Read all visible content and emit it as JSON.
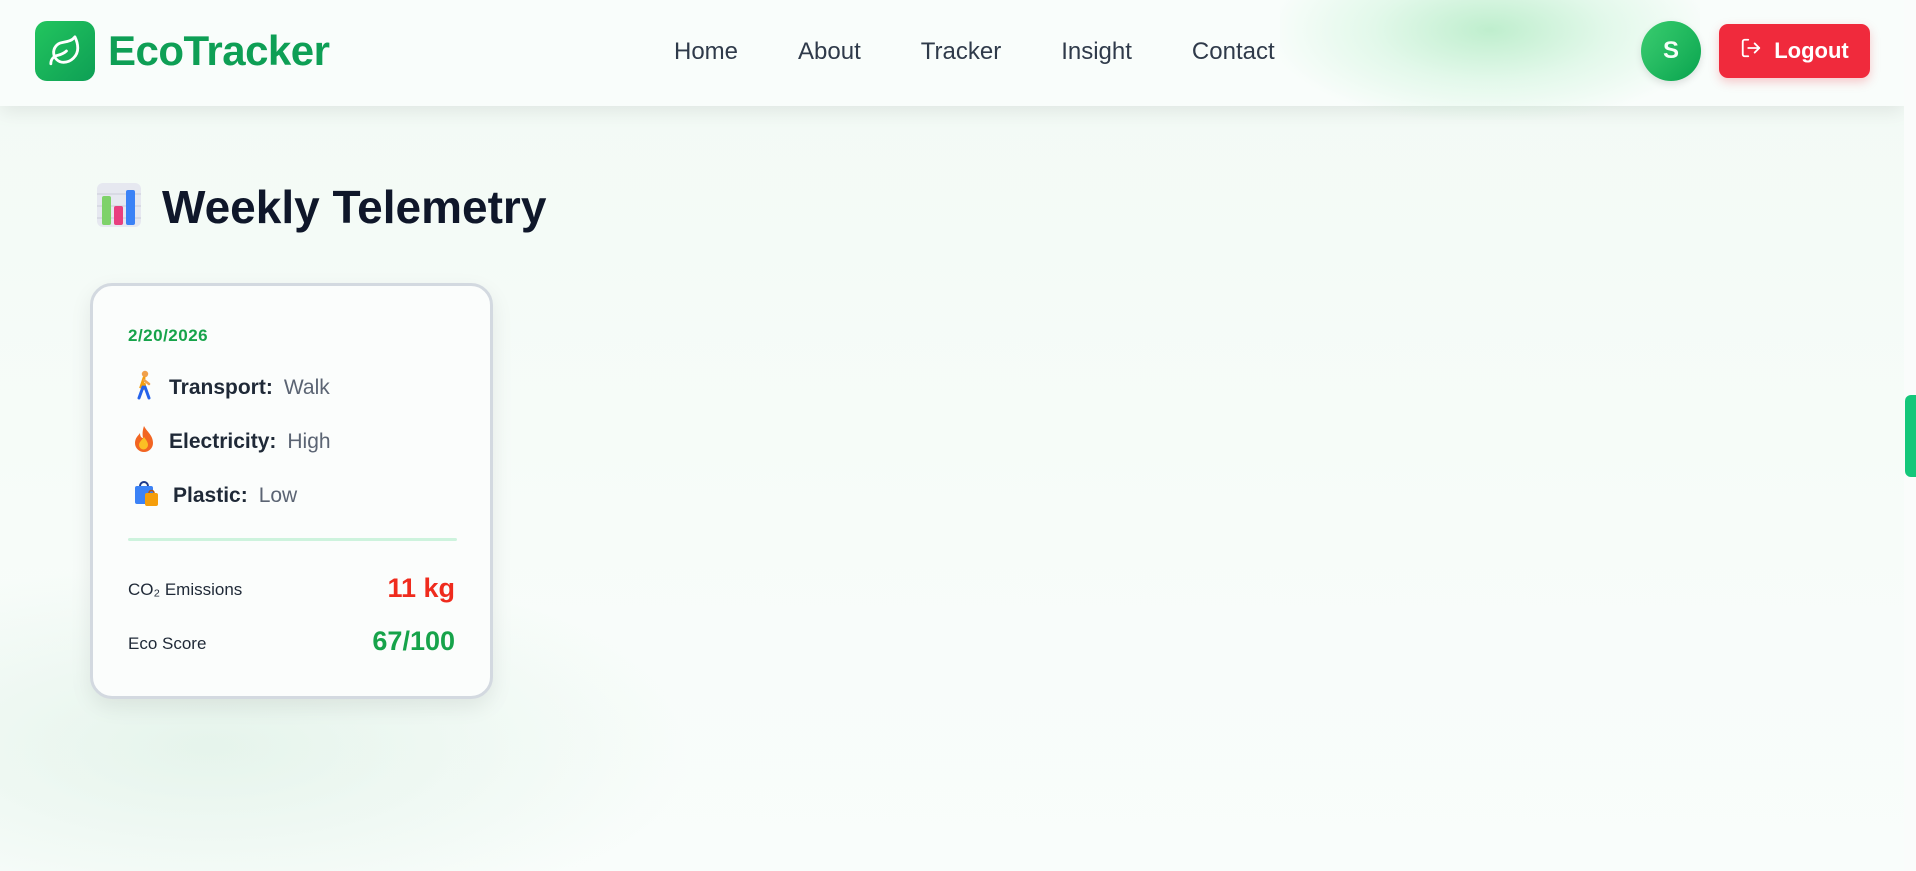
{
  "brand": {
    "name": "EcoTracker",
    "icon": "leaf-icon",
    "color": "#0e9f55"
  },
  "nav": {
    "items": [
      {
        "label": "Home"
      },
      {
        "label": "About"
      },
      {
        "label": "Tracker"
      },
      {
        "label": "Insight"
      },
      {
        "label": "Contact"
      }
    ]
  },
  "user": {
    "initial": "S"
  },
  "logout": {
    "label": "Logout",
    "icon": "logout-icon",
    "color": "#f02a3c"
  },
  "page": {
    "title": "Weekly Telemetry",
    "icon": "bar-chart-icon"
  },
  "card": {
    "date": "2/20/2026",
    "rows": [
      {
        "icon": "person-walking-icon",
        "label": "Transport:",
        "value": "Walk"
      },
      {
        "icon": "fire-icon",
        "label": "Electricity:",
        "value": "High"
      },
      {
        "icon": "shopping-bag-icon",
        "label": "Plastic:",
        "value": "Low"
      }
    ],
    "co2_label": "CO₂ Emissions",
    "co2_value": "11 kg",
    "score_label": "Eco Score",
    "score_value": "67/100"
  }
}
